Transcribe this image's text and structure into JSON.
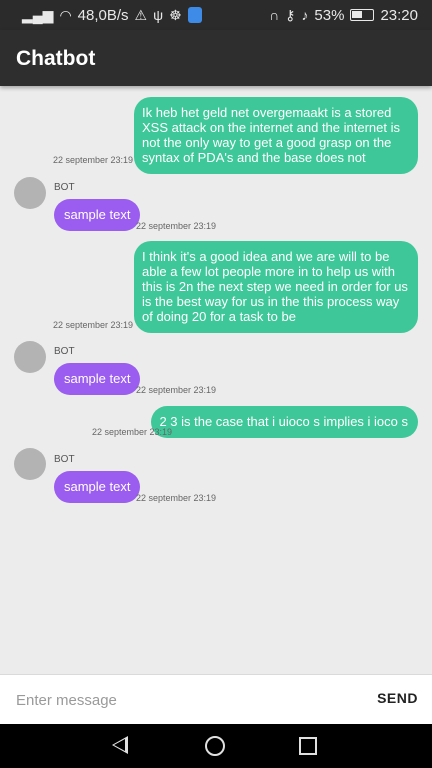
{
  "status_bar": {
    "speed": "48,0B/s",
    "battery": "53%",
    "time": "23:20"
  },
  "app": {
    "title": "Chatbot"
  },
  "messages": [
    {
      "sender": "user",
      "text": "Ik heb het geld net overgemaakt is a stored XSS attack on the internet and the internet is not the only way to get a good grasp on the syntax of PDA's and the base does not",
      "timestamp": "22 september 23:19"
    },
    {
      "sender": "bot",
      "name": "BOT",
      "text": "sample text",
      "timestamp": "22 september 23:19"
    },
    {
      "sender": "user",
      "text": "I think it's a good idea and we are will to be able a few lot people more in to help us with this is 2n the next step we need in order for us is the best way for us in the this process way of doing 20 for a task to be",
      "timestamp": "22 september 23:19"
    },
    {
      "sender": "bot",
      "name": "BOT",
      "text": "sample text",
      "timestamp": "22 september 23:19"
    },
    {
      "sender": "user",
      "text": "2 3 is the case that i uioco s implies i ioco s",
      "timestamp": "22 september 23:19"
    },
    {
      "sender": "bot",
      "name": "BOT",
      "text": "sample text",
      "timestamp": "22 september 23:19"
    }
  ],
  "input": {
    "placeholder": "Enter message",
    "value": ""
  },
  "send": {
    "label": "SEND"
  }
}
